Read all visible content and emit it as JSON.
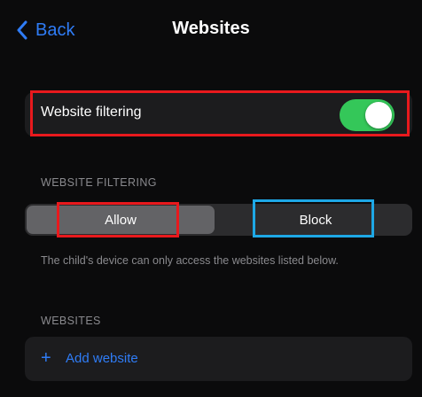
{
  "nav": {
    "back_label": "Back",
    "title": "Websites"
  },
  "filter": {
    "label": "Website filtering",
    "enabled": true
  },
  "mode": {
    "section_header": "WEBSITE FILTERING",
    "options": [
      "Allow",
      "Block"
    ],
    "selected": "Allow",
    "footnote": "The child's device can only access the websites listed below."
  },
  "websites": {
    "section_header": "WEBSITES",
    "add_label": "Add website",
    "add_icon": "plus-icon"
  },
  "colors": {
    "accent": "#2f7cf6",
    "toggle_on": "#34c759",
    "annotation_red": "#e8191d",
    "annotation_blue": "#1ea8e6"
  }
}
